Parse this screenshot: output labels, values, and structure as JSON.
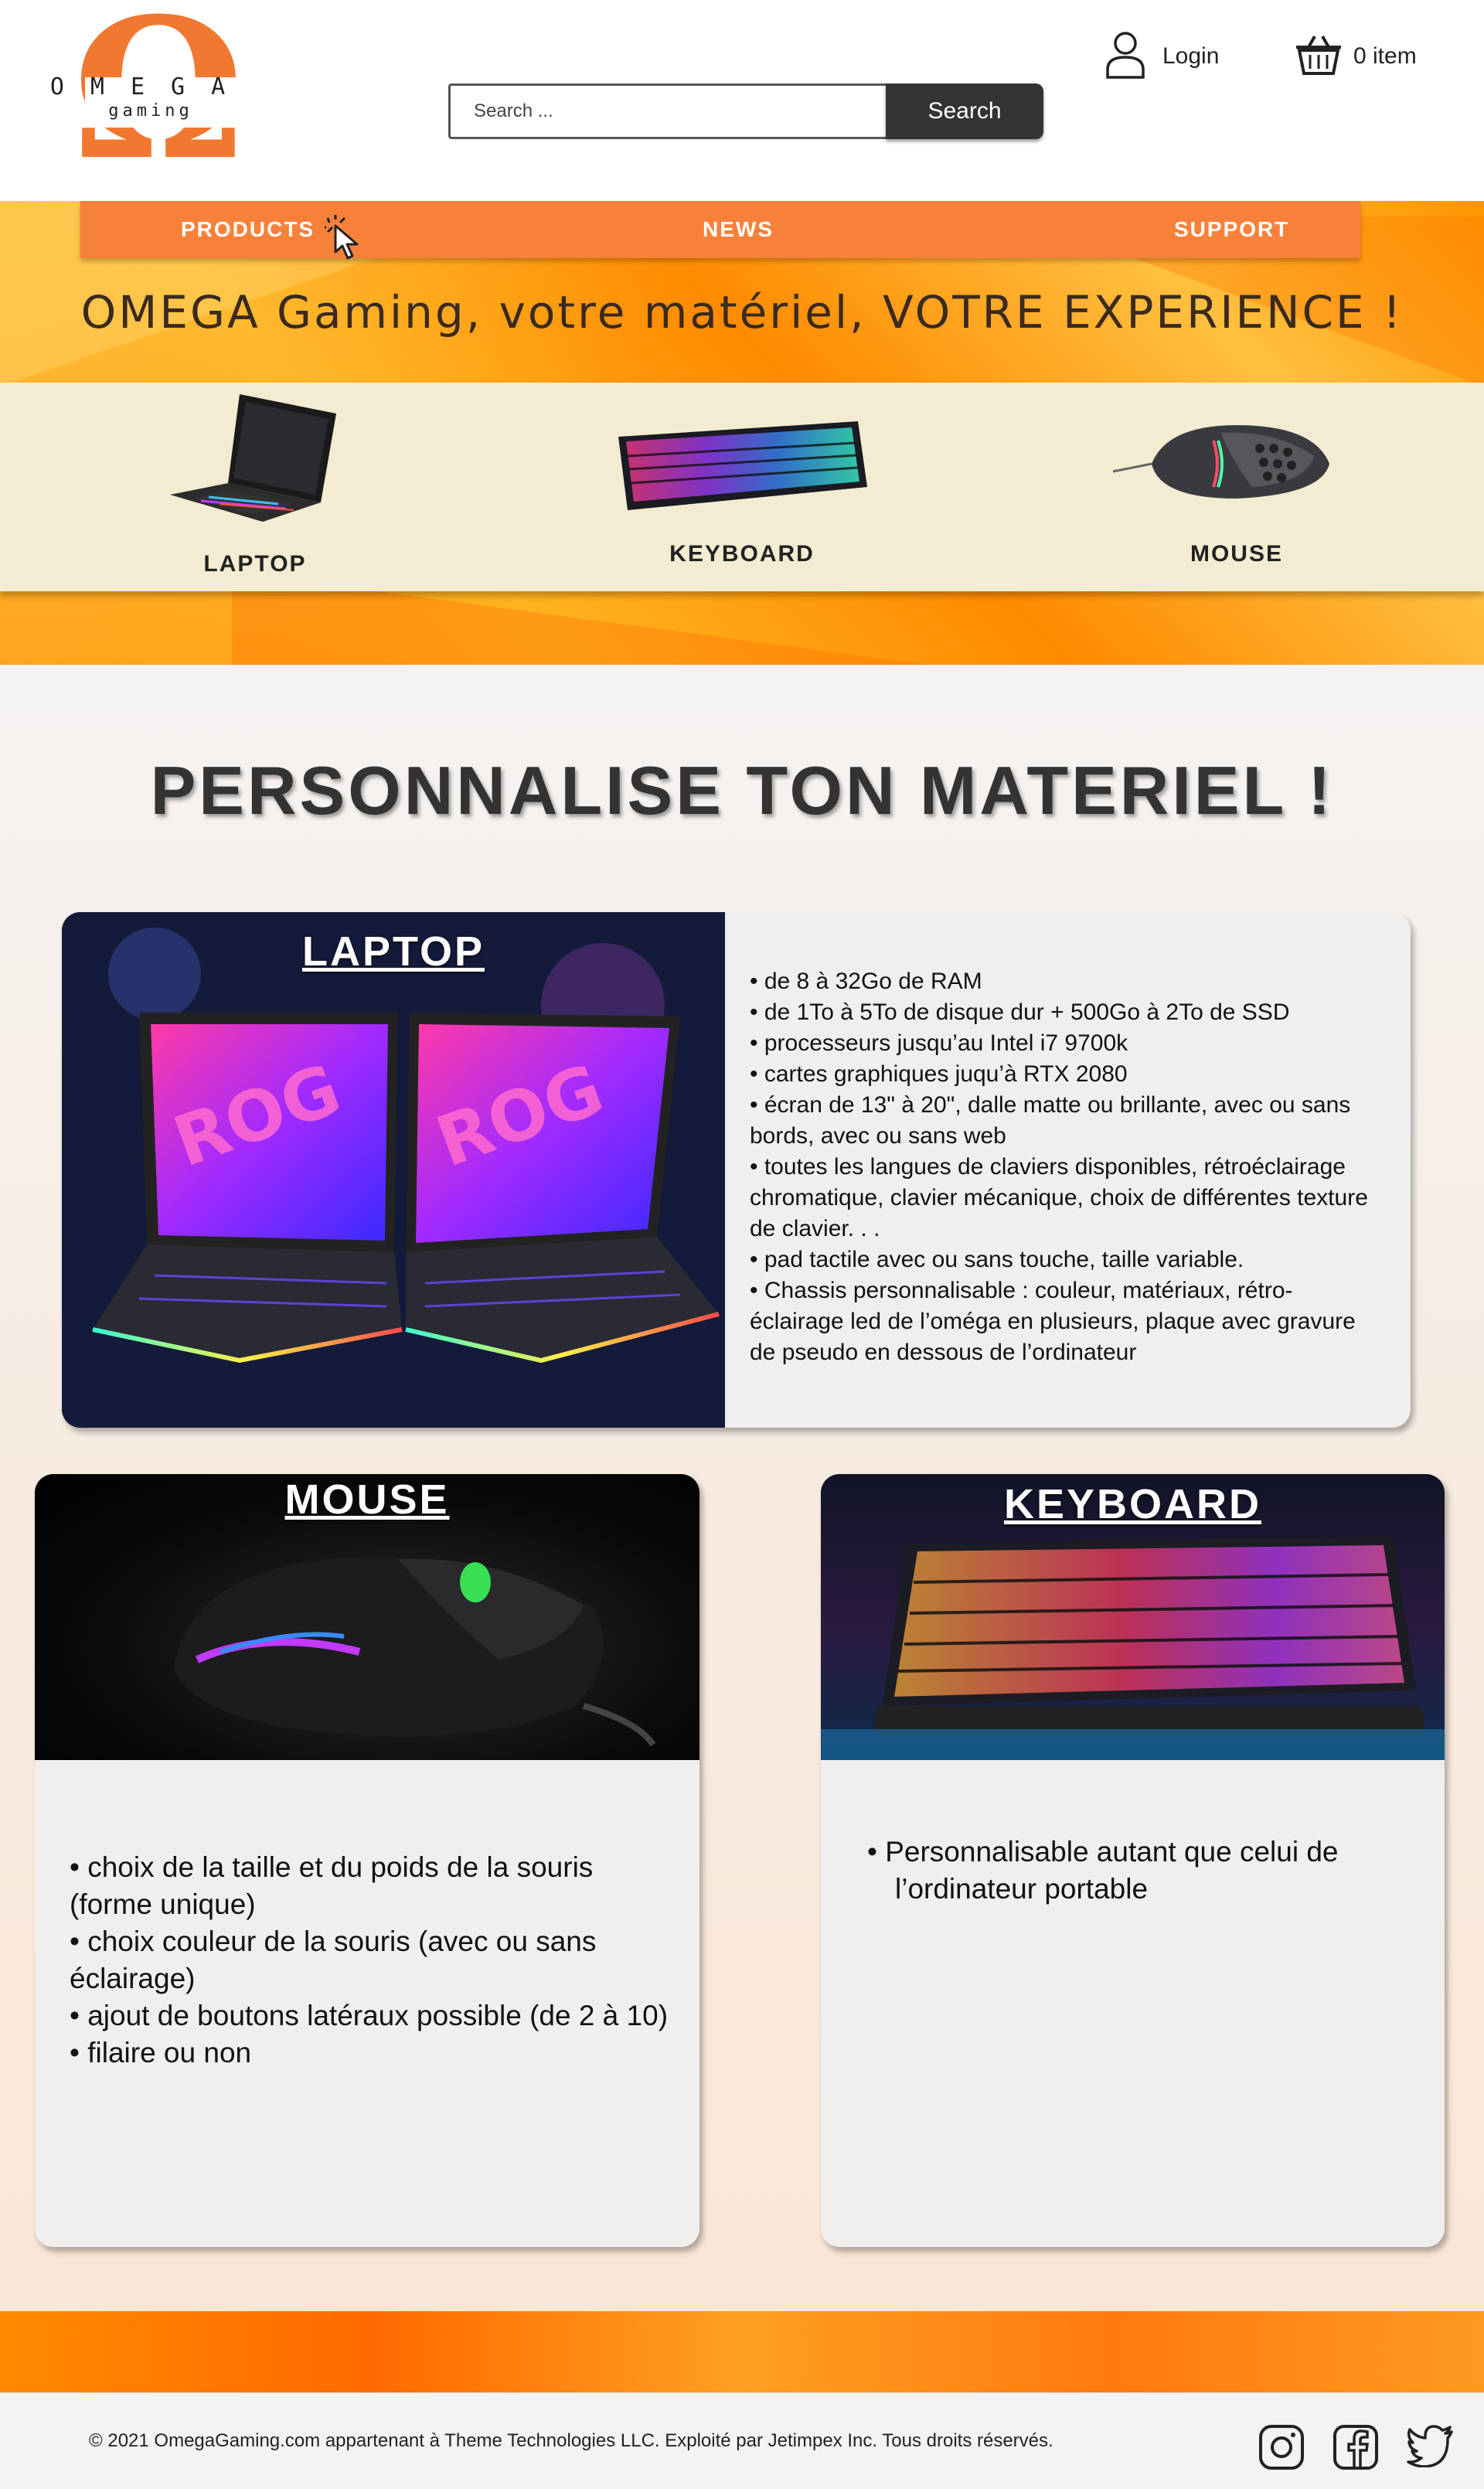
{
  "logo": {
    "omega_glyph": "Ω",
    "name": "OMEGA",
    "sub": "gaming"
  },
  "search": {
    "placeholder": "Search ...",
    "button_label": "Search"
  },
  "account": {
    "login_label": "Login",
    "cart_label": "0 item"
  },
  "nav": {
    "products": "PRODUCTS",
    "news": "NEWS",
    "support": "SUPPORT"
  },
  "tagline": "OMEGA Gaming, votre matériel, VOTRE EXPERIENCE !",
  "categories": [
    {
      "label": "LAPTOP"
    },
    {
      "label": "KEYBOARD"
    },
    {
      "label": "MOUSE"
    }
  ],
  "main": {
    "title": "PERSONNALISE TON MATERIEL !",
    "laptop": {
      "title": "LAPTOP",
      "specs": [
        "• de 8 à 32Go de RAM",
        "• de 1To à 5To de disque dur + 500Go à 2To de SSD",
        "• processeurs jusqu’au Intel i7 9700k",
        "• cartes graphiques juqu’à RTX 2080",
        "• écran de 13\" à 20\", dalle matte ou brillante, avec ou sans bords, avec ou sans web",
        "• toutes les langues de claviers disponibles, rétroéclairage chromatique, clavier mécanique, choix de différentes texture de clavier. . .",
        "• pad tactile avec ou sans touche, taille variable.",
        "• Chassis personnalisable : couleur, matériaux, rétro-éclairage led de l’oméga en plusieurs, plaque avec gravure de pseudo en dessous de l’ordinateur"
      ]
    },
    "mouse": {
      "title": "MOUSE",
      "specs": [
        "• choix de la taille et du poids de la souris (forme unique)",
        "• choix couleur de la souris (avec ou sans éclairage)",
        "• ajout de boutons latéraux possible (de 2 à 10)",
        "• filaire ou non"
      ]
    },
    "keyboard": {
      "title": "KEYBOARD",
      "specs": [
        "•  Personnalisable autant que celui de l’ordinateur portable"
      ]
    }
  },
  "footer": {
    "copyright": "© 2021 OmegaGaming.com appartenant à Theme Technologies LLC. Exploité par Jetimpex Inc. Tous droits réservés."
  },
  "colors": {
    "accent": "#f7813a",
    "logo_orange": "#f07830",
    "search_button": "#333333"
  }
}
